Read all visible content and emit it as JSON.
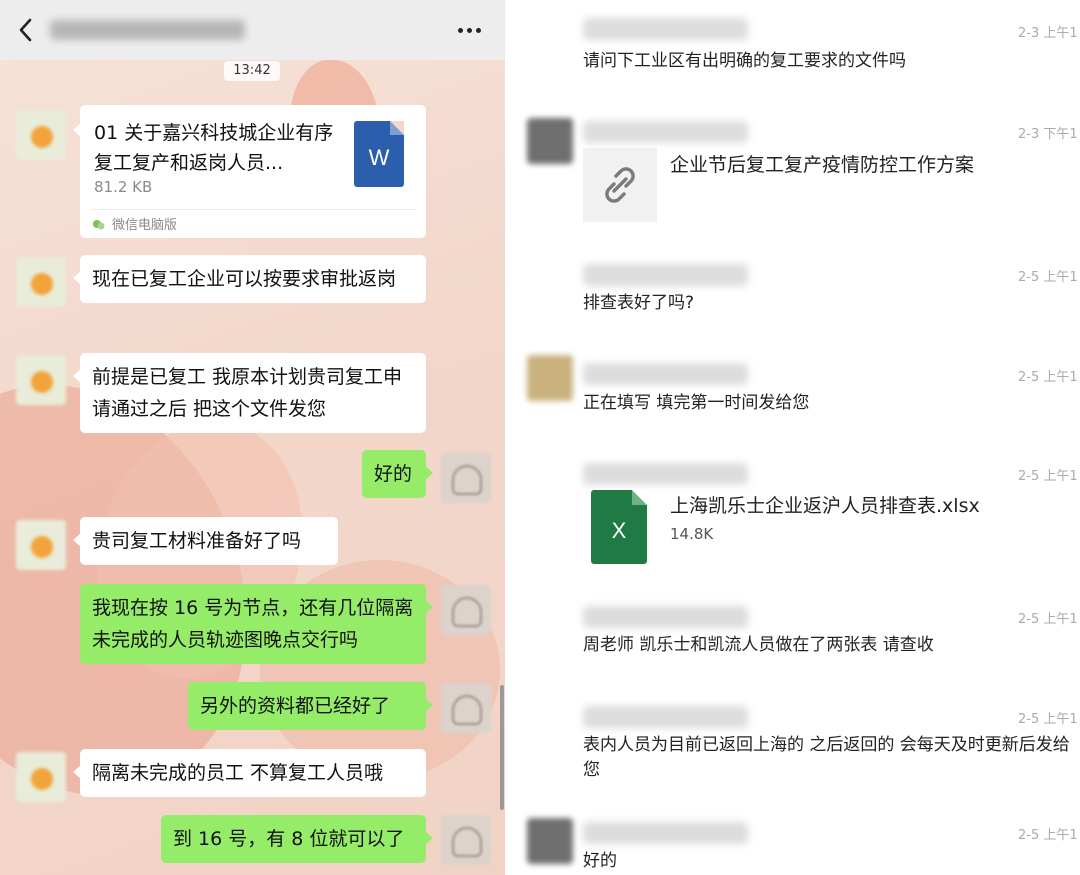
{
  "left_chat": {
    "title": "",
    "timestamp": "13:42",
    "file": {
      "name": "01 关于嘉兴科技城企业有序复工复产和返岗人员...",
      "size": "81.2 KB",
      "type_icon_letter": "W",
      "source": "微信电脑版"
    },
    "messages": [
      {
        "side": "in",
        "text": "现在已复工企业可以按要求审批返岗"
      },
      {
        "side": "in",
        "text": "前提是已复工 我原本计划贵司复工申请通过之后 把这个文件发您"
      },
      {
        "side": "out",
        "text": "好的"
      },
      {
        "side": "in",
        "text": "贵司复工材料准备好了吗"
      },
      {
        "side": "out",
        "text": "我现在按 16 号为节点，还有几位隔离未完成的人员轨迹图晚点交行吗"
      },
      {
        "side": "out",
        "text": "另外的资料都已经好了"
      },
      {
        "side": "in",
        "text": "隔离未完成的员工 不算复工人员哦"
      },
      {
        "side": "out",
        "text": "到 16 号，有 8 位就可以了"
      }
    ]
  },
  "right_history": {
    "items": [
      {
        "time": "2-3 上午1",
        "text": "请问下工业区有出明确的复工要求的文件吗"
      },
      {
        "time": "2-3 下午1",
        "link_title": "企业节后复工复产疫情防控工作方案",
        "link_icon": "link-chain-icon"
      },
      {
        "time": "2-5 上午1",
        "text": "排查表好了吗?"
      },
      {
        "time": "2-5 上午1",
        "text": "正在填写 填完第一时间发给您"
      },
      {
        "time": "2-5 上午1",
        "file_name": "上海凯乐士企业返沪人员排查表.xlsx",
        "file_size": "14.8K",
        "type_icon_letter": "X"
      },
      {
        "time": "2-5 上午1",
        "text": "周老师 凯乐士和凯流人员做在了两张表 请查收"
      },
      {
        "time": "2-5 上午1",
        "text": "表内人员为目前已返回上海的 之后返回的 会每天及时更新后发给您"
      },
      {
        "time": "2-5 上午1",
        "text": "好的"
      }
    ]
  },
  "colors": {
    "incoming_bubble": "#ffffff",
    "outgoing_bubble": "#95ec69",
    "word_blue": "#2b5fae",
    "excel_green": "#1f7a43",
    "topbar": "#ededed"
  }
}
